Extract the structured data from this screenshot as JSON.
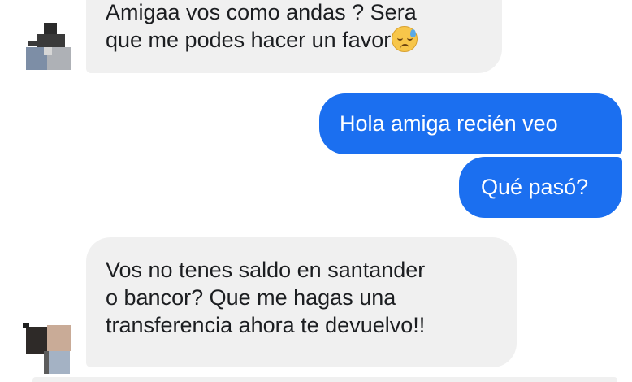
{
  "conversation": {
    "messages": [
      {
        "sender": "contact",
        "lines": [
          "Amigaa vos como andas ? Sera",
          "que me podes hacer un favor"
        ],
        "emoji": "downcast-sweat-face-emoji"
      },
      {
        "sender": "me",
        "lines": [
          "Hola amiga recién veo"
        ]
      },
      {
        "sender": "me",
        "lines": [
          "Qué pasó?"
        ]
      },
      {
        "sender": "contact",
        "lines": [
          "Vos no tenes saldo en santander",
          "o bancor? Que me hagas una",
          "transferencia ahora te devuelvo!!"
        ]
      }
    ]
  },
  "colors": {
    "incoming_bubble": "#f0f0f0",
    "outgoing_bubble": "#1b6ff0",
    "incoming_text": "#1c1e21",
    "outgoing_text": "#ffffff"
  }
}
